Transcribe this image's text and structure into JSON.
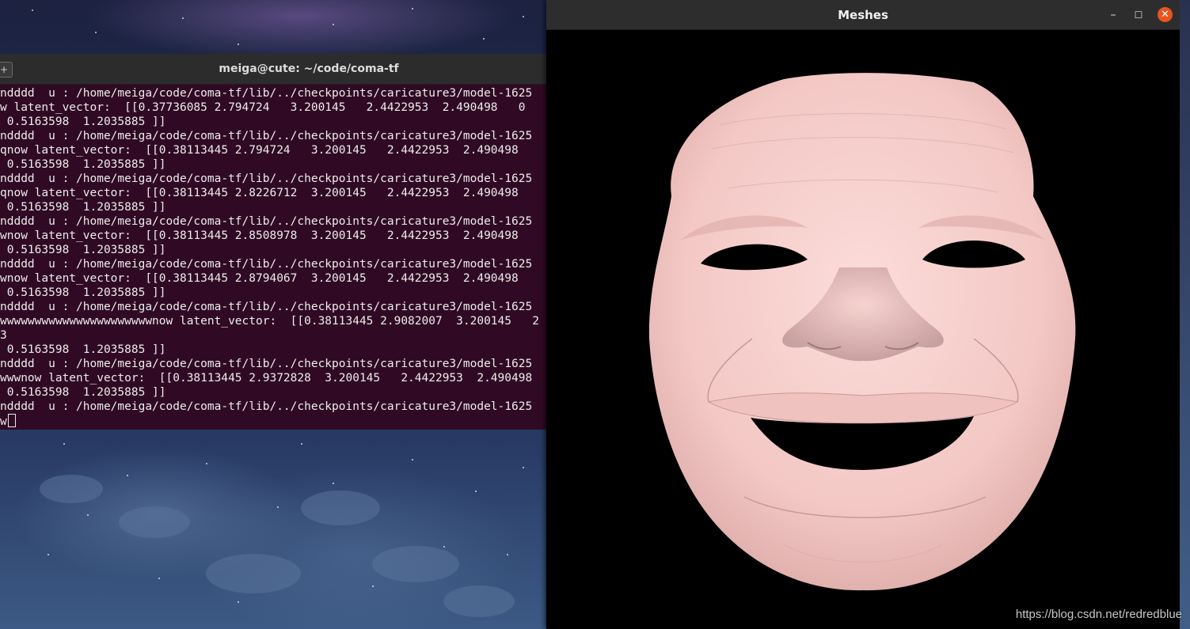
{
  "terminal": {
    "title": "meiga@cute: ~/code/coma-tf",
    "new_tab_label": "+",
    "lines": [
      "ndddd  u : /home/meiga/code/coma-tf/lib/../checkpoints/caricature3/model-1625",
      "w latent_vector:  [[0.37736085 2.794724   3.200145   2.4422953  2.490498   0",
      " 0.5163598  1.2035885 ]]",
      "ndddd  u : /home/meiga/code/coma-tf/lib/../checkpoints/caricature3/model-1625",
      "qnow latent_vector:  [[0.38113445 2.794724   3.200145   2.4422953  2.490498",
      " 0.5163598  1.2035885 ]]",
      "ndddd  u : /home/meiga/code/coma-tf/lib/../checkpoints/caricature3/model-1625",
      "qnow latent_vector:  [[0.38113445 2.8226712  3.200145   2.4422953  2.490498",
      " 0.5163598  1.2035885 ]]",
      "ndddd  u : /home/meiga/code/coma-tf/lib/../checkpoints/caricature3/model-1625",
      "wnow latent_vector:  [[0.38113445 2.8508978  3.200145   2.4422953  2.490498",
      " 0.5163598  1.2035885 ]]",
      "ndddd  u : /home/meiga/code/coma-tf/lib/../checkpoints/caricature3/model-1625",
      "wnow latent_vector:  [[0.38113445 2.8794067  3.200145   2.4422953  2.490498",
      " 0.5163598  1.2035885 ]]",
      "ndddd  u : /home/meiga/code/coma-tf/lib/../checkpoints/caricature3/model-1625",
      "wwwwwwwwwwwwwwwwwwwwwwnow latent_vector:  [[0.38113445 2.9082007  3.200145   2",
      "3",
      " 0.5163598  1.2035885 ]]",
      "ndddd  u : /home/meiga/code/coma-tf/lib/../checkpoints/caricature3/model-1625",
      "wwwnow latent_vector:  [[0.38113445 2.9372828  3.200145   2.4422953  2.490498",
      " 0.5163598  1.2035885 ]]",
      "ndddd  u : /home/meiga/code/coma-tf/lib/../checkpoints/caricature3/model-1625"
    ],
    "prompt_line": "w"
  },
  "meshes": {
    "title": "Meshes",
    "minimize_label": "–",
    "maximize_label": "☐",
    "close_label": "✕",
    "face_color": "#f6cdca"
  },
  "watermark": "https://blog.csdn.net/redredblue"
}
